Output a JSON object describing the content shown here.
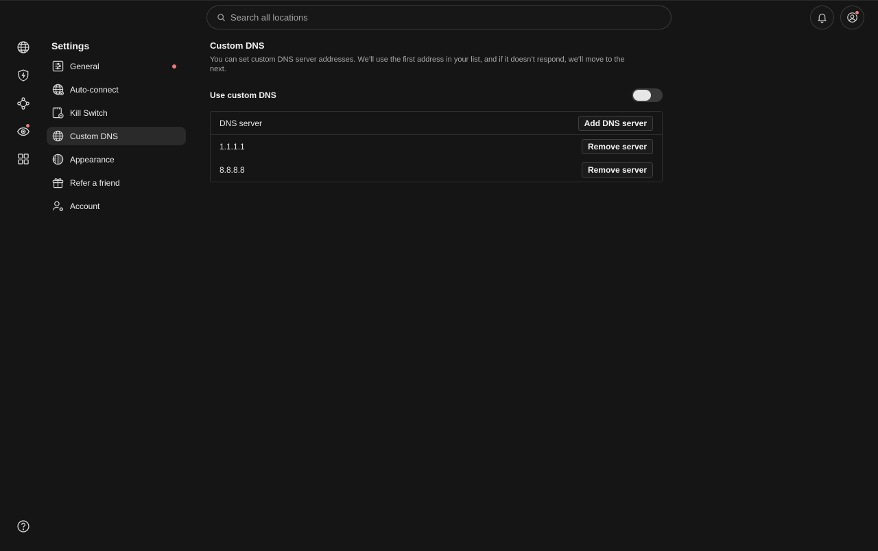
{
  "search": {
    "placeholder": "Search all locations"
  },
  "settings": {
    "title": "Settings",
    "items": [
      {
        "label": "General",
        "icon": "sliders-icon",
        "badge": true
      },
      {
        "label": "Auto-connect",
        "icon": "globe-connect-icon"
      },
      {
        "label": "Kill Switch",
        "icon": "kill-switch-icon"
      },
      {
        "label": "Custom DNS",
        "icon": "globe-dns-icon",
        "active": true
      },
      {
        "label": "Appearance",
        "icon": "contrast-icon"
      },
      {
        "label": "Refer a friend",
        "icon": "gift-icon"
      },
      {
        "label": "Account",
        "icon": "user-gear-icon"
      }
    ]
  },
  "main": {
    "title": "Custom DNS",
    "description": "You can set custom DNS server addresses. We’ll use the first address in your list, and if it doesn’t respond, we’ll move to the next.",
    "toggle_label": "Use custom DNS",
    "toggle_on": false,
    "table": {
      "header": "DNS server",
      "add_label": "Add DNS server",
      "rows": [
        {
          "value": "1.1.1.1",
          "action": "Remove server"
        },
        {
          "value": "8.8.8.8",
          "action": "Remove server"
        }
      ]
    }
  },
  "colors": {
    "background": "#151515",
    "accent_dot": "#f07a7a",
    "active_item": "#2a2a2a"
  }
}
